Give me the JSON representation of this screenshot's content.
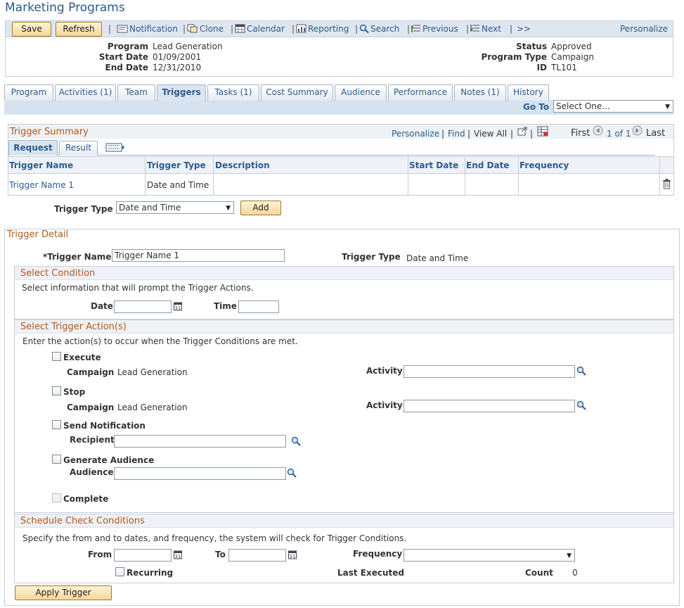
{
  "page": {
    "title": "Marketing Programs"
  },
  "toolbar": {
    "save_label": "Save",
    "refresh_label": "Refresh",
    "notification_label": "Notification",
    "clone_label": "Clone",
    "calendar_label": "Calendar",
    "reporting_label": "Reporting",
    "search_label": "Search",
    "previous_label": "Previous",
    "next_label": "Next",
    "more_label": ">>",
    "personalize_label": "Personalize",
    "separator": "|"
  },
  "header": {
    "program_label": "Program",
    "program_value": "Lead Generation",
    "start_label": "Start Date",
    "start_value": "01/09/2001",
    "end_label": "End Date",
    "end_value": "12/31/2010",
    "status_label": "Status",
    "status_value": "Approved",
    "type_label": "Program Type",
    "type_value": "Campaign",
    "id_label": "ID",
    "id_value": "TL101"
  },
  "tabs": [
    {
      "label": "Program"
    },
    {
      "label": "Activities (1)"
    },
    {
      "label": "Team"
    },
    {
      "label": "Triggers"
    },
    {
      "label": "Tasks (1)"
    },
    {
      "label": "Cost Summary"
    },
    {
      "label": "Audience"
    },
    {
      "label": "Performance"
    },
    {
      "label": "Notes (1)"
    },
    {
      "label": "History"
    }
  ],
  "goto": {
    "label": "Go To",
    "value": "Select One..."
  },
  "summary": {
    "title": "Trigger Summary",
    "personalize": "Personalize",
    "find": "Find",
    "view_all": "View All",
    "first": "First",
    "page_info": "1 of 1",
    "last": "Last",
    "separator": "|",
    "subtabs": [
      {
        "label": "Request"
      },
      {
        "label": "Result"
      }
    ],
    "columns": [
      "Trigger Name",
      "Trigger Type",
      "Description",
      "Start Date",
      "End Date",
      "Frequency"
    ],
    "rows": [
      {
        "name": "Trigger Name 1",
        "type": "Date and Time"
      }
    ]
  },
  "add_row": {
    "label": "Trigger Type",
    "value": "Date and Time",
    "add_label": "Add"
  },
  "detail": {
    "title": "Trigger Detail",
    "name_label": "*Trigger Name",
    "name_value": "Trigger Name 1",
    "type_label": "Trigger Type",
    "type_value": "Date and Time",
    "condition": {
      "title": "Select Condition",
      "instruction": "Select information that will prompt the Trigger Actions.",
      "date_label": "Date",
      "time_label": "Time"
    },
    "actions": {
      "title": "Select Trigger Action(s)",
      "instruction": "Enter the action(s) to occur when the Trigger Conditions are met.",
      "execute_label": "Execute",
      "stop_label": "Stop",
      "campaign_label": "Campaign",
      "campaign_value": "Lead Generation",
      "activity_label": "Activity",
      "send_label": "Send Notification",
      "recipient_label": "Recipient",
      "generate_label": "Generate Audience",
      "audience_label": "Audience",
      "complete_label": "Complete"
    },
    "schedule": {
      "title": "Schedule Check Conditions",
      "instruction": "Specify the from and to dates, and frequency, the system will check for Trigger Conditions.",
      "from_label": "From",
      "to_label": "To",
      "frequency_label": "Frequency",
      "recurring_label": "Recurring",
      "last_label": "Last Executed",
      "count_label": "Count",
      "count_value": "0"
    },
    "apply_label": "Apply Trigger"
  },
  "colors": {
    "accent": "#2c5d8f",
    "section": "#b05a1a",
    "button": "#f5d79b"
  }
}
